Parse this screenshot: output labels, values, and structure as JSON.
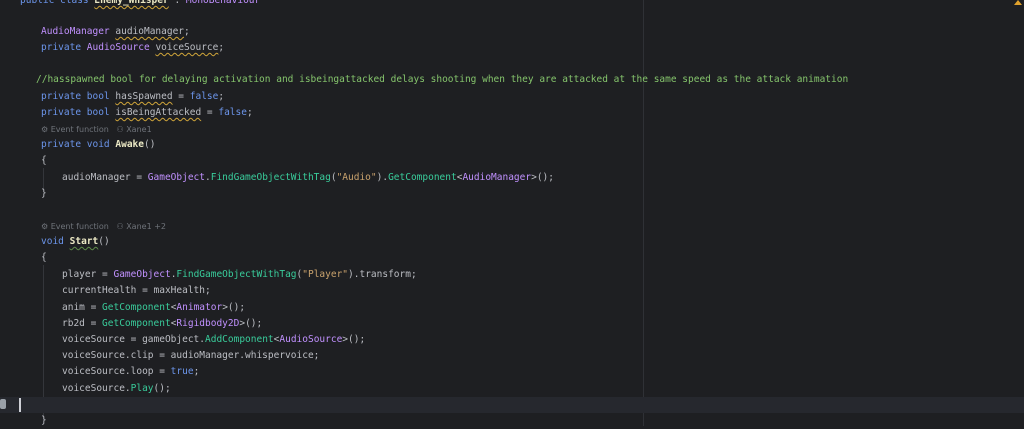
{
  "header": {
    "class_line": "public class Enemy_Whisper : MonoBehaviour"
  },
  "fields": [
    "AudioManager audioManager;",
    "private AudioSource voiceSource;"
  ],
  "comment": "//hasspawned bool for delaying activation and isbeingattacked delays shooting when they are attacked at the same speed as the attack animation",
  "bools": [
    "private bool hasSpawned = false;",
    "private bool isBeingAttacked = false;"
  ],
  "awake_hint": {
    "event": "Event function",
    "author": "Xane1"
  },
  "awake_sig": "private void Awake()",
  "awake_body": "audioManager = GameObject.FindGameObjectWithTag(\"Audio\").GetComponent<AudioManager>();",
  "start_hint": {
    "event": "Event function",
    "author": "Xane1 +2"
  },
  "start_sig": "void Start()",
  "start_body": [
    "player = GameObject.FindGameObjectWithTag(\"Player\").transform;",
    "currentHealth = maxHealth;",
    "anim = GetComponent<Animator>();",
    "rb2d = GetComponent<Rigidbody2D>();",
    "voiceSource = gameObject.AddComponent<AudioSource>();",
    "voiceSource.clip = audioManager.whispervoice;",
    "voiceSource.loop = true;",
    "voiceSource.Play();"
  ],
  "brace_open": "{",
  "brace_close": "}",
  "colors": {
    "background": "#1e1f22",
    "keyword": "#6c95eb",
    "method": "#39cc9b",
    "type": "#c191ff",
    "string": "#c9a26d",
    "comment": "#85c46c"
  },
  "icons": [
    "warning-icon",
    "gutter-breakpoint-icon",
    "event-function-icon",
    "author-icon"
  ]
}
